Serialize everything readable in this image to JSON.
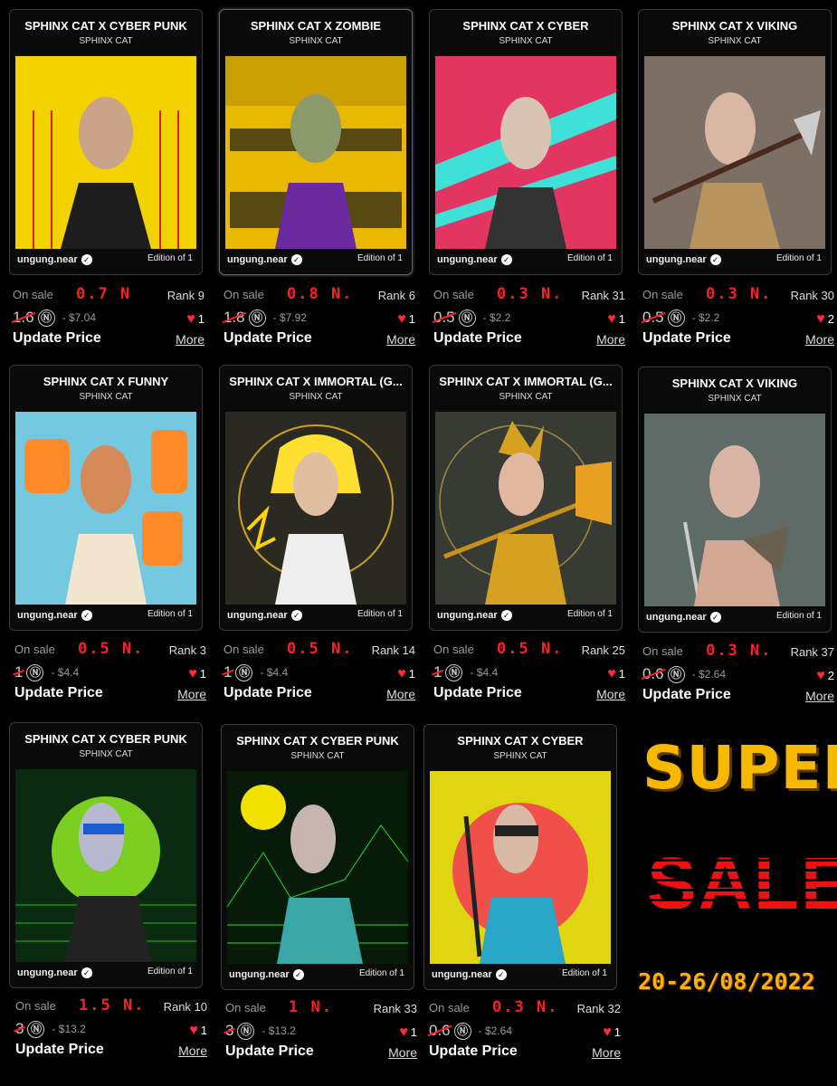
{
  "collection": "SPHINX CAT",
  "owner": "ungung.near",
  "edition": "Edition of 1",
  "on_sale_label": "On sale",
  "update_label": "Update Price",
  "more_label": "More",
  "near_symbol": "Ⓝ",
  "cards": [
    {
      "title": "SPHINX CAT X CYBER PUNK",
      "old_price": "1.6",
      "usd": "- $7.04",
      "rank": "Rank 9",
      "likes": "1",
      "new_price": "0.7 N",
      "bg": "#f2d300"
    },
    {
      "title": "SPHINX CAT X ZOMBIE",
      "old_price": "1.8",
      "usd": "- $7.92",
      "rank": "Rank 6",
      "likes": "1",
      "new_price": "0.8 N.",
      "bg": "#e9b800"
    },
    {
      "title": "SPHINX CAT X CYBER",
      "old_price": "0.5",
      "usd": "- $2.2",
      "rank": "Rank 31",
      "likes": "1",
      "new_price": "0.3 N.",
      "bg": "#e33562"
    },
    {
      "title": "SPHINX CAT X VIKING",
      "old_price": "0.5",
      "usd": "- $2.2",
      "rank": "Rank 30",
      "likes": "2",
      "new_price": "0.3 N.",
      "bg": "#7b6f66"
    },
    {
      "title": "SPHINX CAT X FUNNY",
      "old_price": "1",
      "usd": "- $4.4",
      "rank": "Rank 3",
      "likes": "1",
      "new_price": "0.5 N.",
      "bg": "#74c9e0"
    },
    {
      "title": "SPHINX CAT X IMMORTAL (G...",
      "old_price": "1",
      "usd": "- $4.4",
      "rank": "Rank 14",
      "likes": "1",
      "new_price": "0.5 N.",
      "bg": "#2b2a22"
    },
    {
      "title": "SPHINX CAT X IMMORTAL (G...",
      "old_price": "1",
      "usd": "- $4.4",
      "rank": "Rank 25",
      "likes": "1",
      "new_price": "0.5 N.",
      "bg": "#383a34"
    },
    {
      "title": "SPHINX CAT X VIKING",
      "old_price": "0.6",
      "usd": "- $2.64",
      "rank": "Rank 37",
      "likes": "2",
      "new_price": "0.3 N.",
      "bg": "#5f6b66"
    },
    {
      "title": "SPHINX CAT X CYBER PUNK",
      "old_price": "3",
      "usd": "- $13.2",
      "rank": "Rank 10",
      "likes": "1",
      "new_price": "1.5 N.",
      "bg": "#0b2a12"
    },
    {
      "title": "SPHINX CAT X CYBER PUNK",
      "old_price": "3",
      "usd": "- $13.2",
      "rank": "Rank 33",
      "likes": "1",
      "new_price": "1 N.",
      "bg": "#081a08"
    },
    {
      "title": "SPHINX CAT X CYBER",
      "old_price": "0.6",
      "usd": "- $2.64",
      "rank": "Rank 32",
      "likes": "1",
      "new_price": "0.3 N.",
      "bg": "#e0d512"
    }
  ],
  "promo": {
    "super": "SUPER",
    "sale": "SALE",
    "dates": "20-26/08/2022"
  }
}
